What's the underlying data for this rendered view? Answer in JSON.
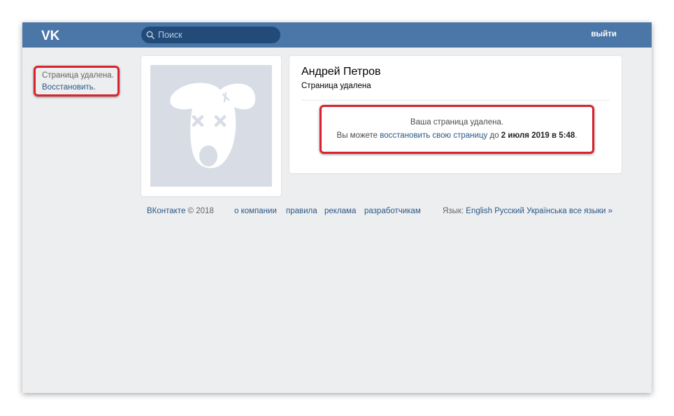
{
  "header": {
    "search_placeholder": "Поиск",
    "logout_label": "выйти"
  },
  "sidebar_notice": {
    "line1": "Страница удалена.",
    "restore_label": "Восстановить."
  },
  "profile": {
    "name": "Андрей Петров",
    "status": "Страница удалена"
  },
  "deleted_notice": {
    "title": "Ваша страница удалена.",
    "text_before": "Вы можете ",
    "restore_link": "восстановить свою страницу",
    "text_middle": " до ",
    "deadline": "2 июля 2019 в 5:48",
    "text_after": "."
  },
  "footer": {
    "brand": "ВКонтакте",
    "copyright": "© 2018",
    "links": [
      "о компании",
      "правила",
      "реклама",
      "разработчикам"
    ],
    "language_label": "Язык:",
    "languages": [
      "English",
      "Русский",
      "Українська",
      "все языки »"
    ]
  },
  "colors": {
    "header": "#4a76a8",
    "search_bg": "#224b7a",
    "page_bg": "#edeef0",
    "link": "#2a5885",
    "highlight_border": "#d9232e",
    "avatar_bg": "#d8dde5"
  }
}
